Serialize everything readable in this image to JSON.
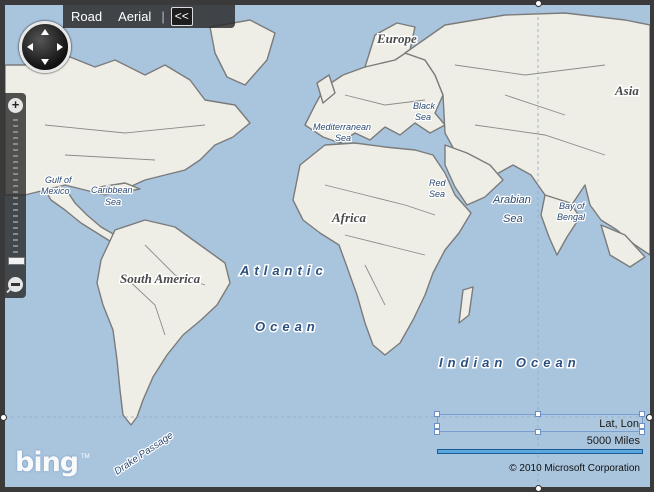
{
  "toolbar": {
    "road_label": "Road",
    "aerial_label": "Aerial",
    "separator": "|",
    "collapse_label": "<<"
  },
  "zoom": {
    "in_label": "+"
  },
  "map_labels": {
    "europe": "Europe",
    "asia": "Asia",
    "africa": "Africa",
    "south_america": "South America",
    "atlantic": "Atlantic",
    "ocean_atl": "Ocean",
    "indian_ocean": "Indian Ocean",
    "mediterranean": "Mediterranean",
    "mediterranean_sea": "Sea",
    "black": "Black",
    "black_sea": "Sea",
    "red": "Red",
    "red_sea": "Sea",
    "arabian": "Arabian",
    "arabian_sea": "Sea",
    "bay_of": "Bay of",
    "bengal": "Bengal",
    "gulf_of": "Gulf of",
    "mexico": "Mexico",
    "caribbean": "Caribbean",
    "caribbean_sea": "Sea",
    "drake_passage": "Drake Passage"
  },
  "info": {
    "lat_lon": "Lat, Lon",
    "scale": "5000 Miles",
    "copyright": "© 2010 Microsoft Corporation"
  },
  "logo": {
    "text": "bing",
    "tm": "TM"
  },
  "colors": {
    "water": "#a9c4dd",
    "land": "#efeee6",
    "border": "#7b7b7b",
    "scale_bar": "#5aa8df"
  }
}
